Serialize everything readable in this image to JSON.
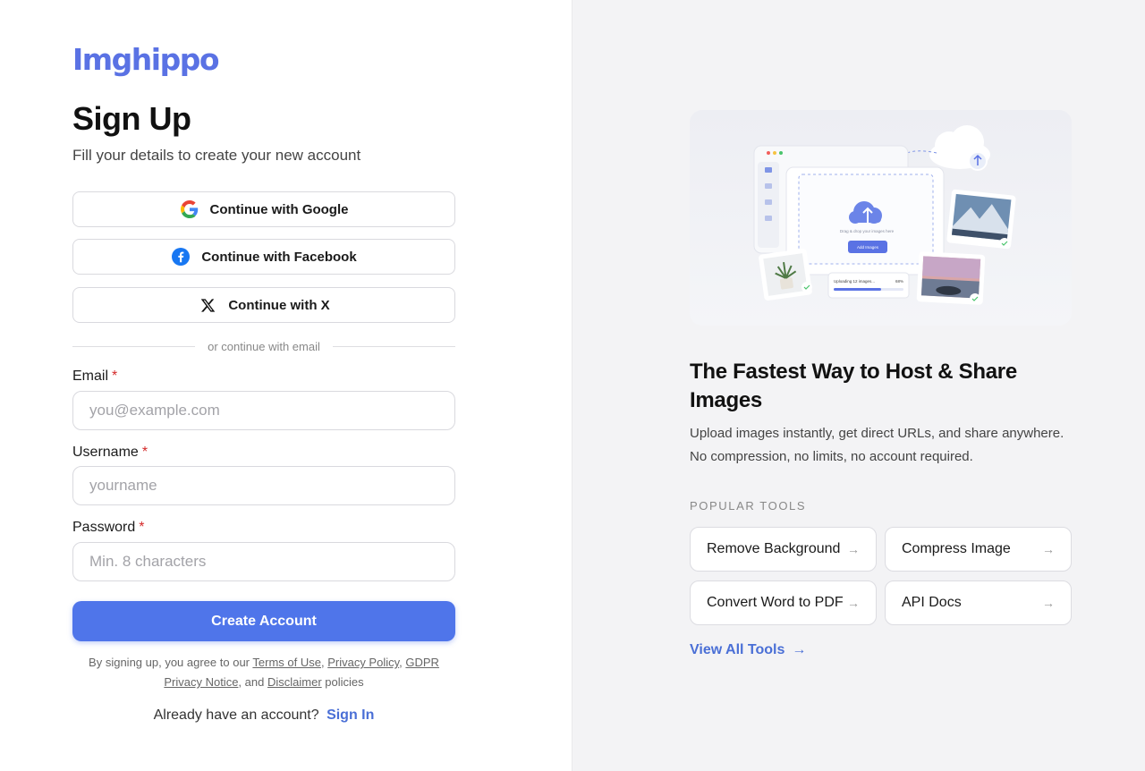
{
  "brand": {
    "logo_text": "Imghippo",
    "accent_color": "#5a72e4",
    "primary_color": "#4f75ea",
    "link_color": "#4a6fd6"
  },
  "signup": {
    "title": "Sign Up",
    "subtitle": "Fill your details to create your new account",
    "social": [
      {
        "label": "Continue with Google",
        "icon": "google-icon"
      },
      {
        "label": "Continue with Facebook",
        "icon": "facebook-icon"
      },
      {
        "label": "Continue with X",
        "icon": "x-icon"
      }
    ],
    "divider_text": "or continue with email",
    "fields": {
      "email": {
        "label": "Email",
        "required_mark": "*",
        "placeholder": "you@example.com",
        "value": ""
      },
      "username": {
        "label": "Username",
        "required_mark": "*",
        "placeholder": "yourname",
        "value": ""
      },
      "password": {
        "label": "Password",
        "required_mark": "*",
        "placeholder": "Min. 8 characters",
        "value": ""
      }
    },
    "submit_label": "Create Account",
    "legal": {
      "prefix": "By signing up, you agree to our",
      "terms": "Terms of Use",
      "privacy": "Privacy Policy",
      "gdpr": "GDPR Privacy Notice",
      "and": "and",
      "disclaimer": "Disclaimer",
      "suffix": "policies"
    },
    "signin_prompt": "Already have an account?",
    "signin_link": "Sign In"
  },
  "promo": {
    "hero_caption": "Drag & drop your images here",
    "hero_button": "Add Images",
    "hero_upload_text": "Uploading 12 images...",
    "hero_upload_percent": "68%",
    "hero_upload_progress": 0.68,
    "title": "The Fastest Way to Host & Share Images",
    "description": "Upload images instantly, get direct URLs, and share anywhere. No compression, no limits, no account required.",
    "section_label": "POPULAR TOOLS",
    "tools": [
      {
        "label": "Remove Background"
      },
      {
        "label": "Compress Image"
      },
      {
        "label": "Convert Word to PDF"
      },
      {
        "label": "API Docs"
      }
    ],
    "view_all": "View All Tools"
  }
}
